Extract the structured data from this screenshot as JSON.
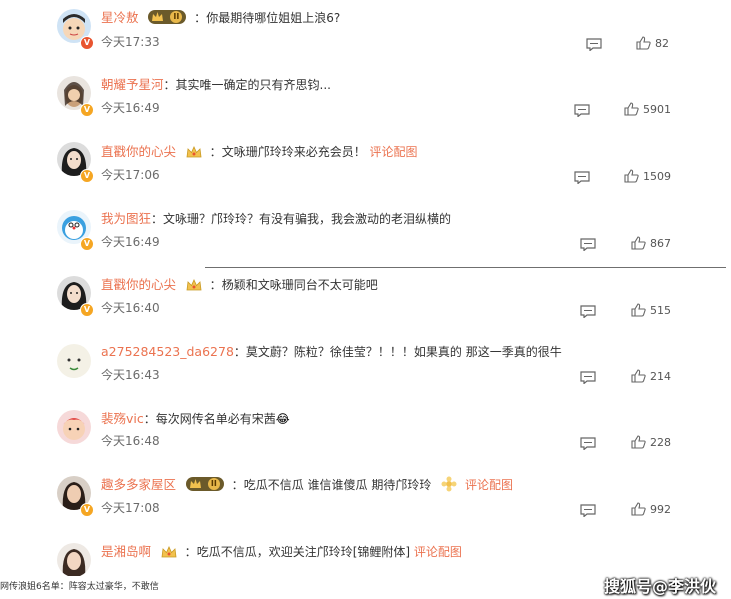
{
  "comments": [
    {
      "user": "星冷敖",
      "sep": "：",
      "text": "你最期待哪位姐姐上浪6?",
      "time": "今天17:33",
      "likes": "82",
      "badge": "level",
      "level": "II"
    },
    {
      "user": "朝耀予星河",
      "sep": "：",
      "text": "其实唯一确定的只有齐思钧...",
      "time": "今天16:49",
      "likes": "5901",
      "badge": "none"
    },
    {
      "user": "直戳你的心尖",
      "sep": "：",
      "text": "文咏珊邝玲玲来必充会员！",
      "topic": "评论配图",
      "time": "今天17:06",
      "likes": "1509",
      "badge": "crown"
    },
    {
      "user": "我为图狂",
      "sep": "：",
      "text": "文咏珊？邝玲玲？有没有骗我，我会激动的老泪纵横的",
      "time": "今天16:49",
      "likes": "867",
      "badge": "none"
    },
    {
      "user": "直戳你的心尖",
      "sep": "：",
      "text": "杨颖和文咏珊同台不太可能吧",
      "time": "今天16:40",
      "likes": "515",
      "badge": "crown"
    },
    {
      "user": "a275284523_da6278",
      "sep": "：",
      "text": "莫文蔚？陈粒？徐佳莹？！！！如果真的 那这一季真的很牛",
      "time": "今天16:43",
      "likes": "214",
      "badge": "none"
    },
    {
      "user": "裴殇vic",
      "sep": "：",
      "text": "每次网传名单必有宋茜",
      "emoji": "😂",
      "time": "今天16:48",
      "likes": "228",
      "badge": "none"
    },
    {
      "user": "趣多多家屋区",
      "sep": "：",
      "text": "吃瓜不信瓜 谁信谁傻瓜 期待邝玲玲",
      "topic": "评论配图",
      "time": "今天17:08",
      "likes": "992",
      "badge": "level",
      "level": "II"
    },
    {
      "user": "是湘岛啊",
      "sep": "：",
      "text": "吃瓜不信瓜，欢迎关注邝玲玲[锦鲤附体]",
      "topic": "评论配图",
      "badge": "crown"
    }
  ],
  "caption": "网传浪姐6名单：阵容太过豪华，不敢信",
  "watermark": "搜狐号@李洪伙",
  "colors": {
    "username": "#eb7350",
    "text": "#333333",
    "time": "#6b6b6b"
  },
  "icons": {
    "comment": "comment-icon",
    "like": "thumbs-up-icon",
    "crown": "crown-icon"
  }
}
